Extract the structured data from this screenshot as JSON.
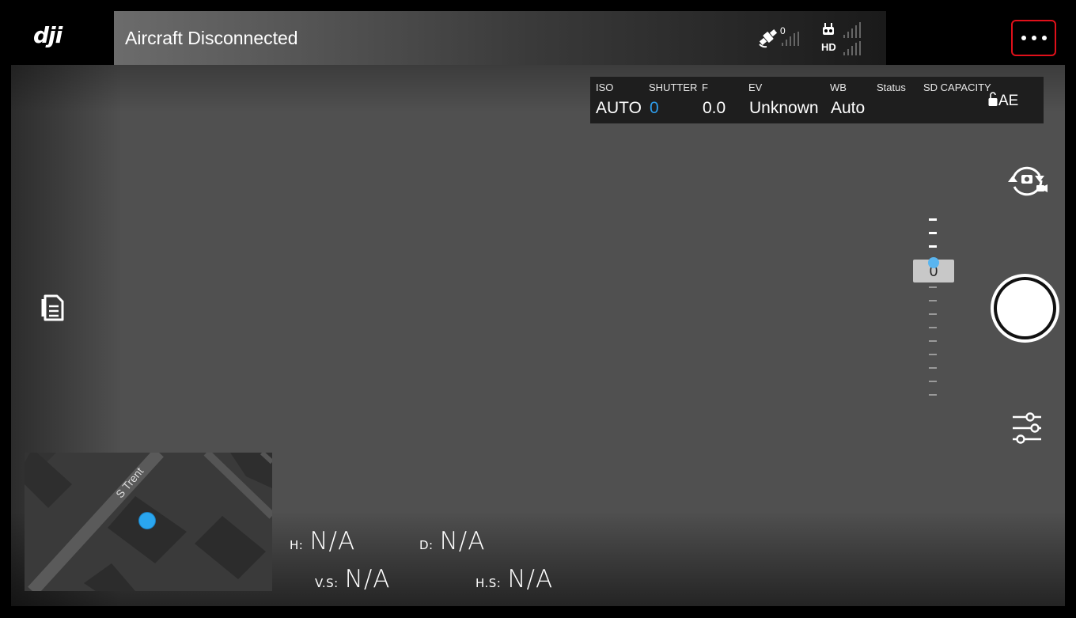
{
  "topbar": {
    "logo": "dji",
    "status": "Aircraft Disconnected",
    "satellite_count": "0",
    "video_link_label": "HD",
    "more_icon": "more-dots-icon",
    "more_border_color": "#e0101a"
  },
  "camera_params": {
    "iso_label": "ISO",
    "iso_value": "AUTO",
    "shutter_label": "SHUTTER",
    "shutter_value": "0",
    "f_label": "F",
    "f_value": "0.0",
    "ev_label": "EV",
    "ev_value": "Unknown",
    "wb_label": "WB",
    "wb_value": "Auto",
    "status_label": "Status",
    "sd_label": "SD CAPACITY",
    "ae_label": "AE",
    "accent_color": "#2d9cea"
  },
  "exposure_ruler": {
    "value": "0"
  },
  "map": {
    "street": "S Trent"
  },
  "telemetry": {
    "h_label": "H:",
    "h_value": "N/A",
    "d_label": "D:",
    "d_value": "N/A",
    "vs_label": "V.S:",
    "vs_value": "N/A",
    "hs_label": "H.S:",
    "hs_value": "N/A"
  },
  "icons": [
    "dji-logo",
    "satellite-icon",
    "remote-controller-icon",
    "more-dots-icon",
    "lock-icon",
    "camera-switch-icon",
    "shutter-button",
    "camera-settings-icon",
    "checklist-icon"
  ]
}
